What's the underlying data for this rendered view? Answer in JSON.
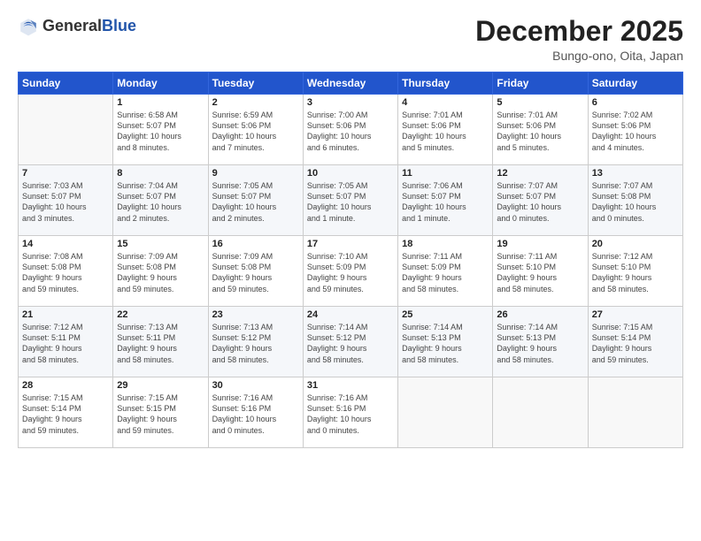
{
  "header": {
    "logo_general": "General",
    "logo_blue": "Blue",
    "month_title": "December 2025",
    "location": "Bungo-ono, Oita, Japan"
  },
  "weekdays": [
    "Sunday",
    "Monday",
    "Tuesday",
    "Wednesday",
    "Thursday",
    "Friday",
    "Saturday"
  ],
  "weeks": [
    [
      {
        "day": "",
        "info": ""
      },
      {
        "day": "1",
        "info": "Sunrise: 6:58 AM\nSunset: 5:07 PM\nDaylight: 10 hours\nand 8 minutes."
      },
      {
        "day": "2",
        "info": "Sunrise: 6:59 AM\nSunset: 5:06 PM\nDaylight: 10 hours\nand 7 minutes."
      },
      {
        "day": "3",
        "info": "Sunrise: 7:00 AM\nSunset: 5:06 PM\nDaylight: 10 hours\nand 6 minutes."
      },
      {
        "day": "4",
        "info": "Sunrise: 7:01 AM\nSunset: 5:06 PM\nDaylight: 10 hours\nand 5 minutes."
      },
      {
        "day": "5",
        "info": "Sunrise: 7:01 AM\nSunset: 5:06 PM\nDaylight: 10 hours\nand 5 minutes."
      },
      {
        "day": "6",
        "info": "Sunrise: 7:02 AM\nSunset: 5:06 PM\nDaylight: 10 hours\nand 4 minutes."
      }
    ],
    [
      {
        "day": "7",
        "info": "Sunrise: 7:03 AM\nSunset: 5:07 PM\nDaylight: 10 hours\nand 3 minutes."
      },
      {
        "day": "8",
        "info": "Sunrise: 7:04 AM\nSunset: 5:07 PM\nDaylight: 10 hours\nand 2 minutes."
      },
      {
        "day": "9",
        "info": "Sunrise: 7:05 AM\nSunset: 5:07 PM\nDaylight: 10 hours\nand 2 minutes."
      },
      {
        "day": "10",
        "info": "Sunrise: 7:05 AM\nSunset: 5:07 PM\nDaylight: 10 hours\nand 1 minute."
      },
      {
        "day": "11",
        "info": "Sunrise: 7:06 AM\nSunset: 5:07 PM\nDaylight: 10 hours\nand 1 minute."
      },
      {
        "day": "12",
        "info": "Sunrise: 7:07 AM\nSunset: 5:07 PM\nDaylight: 10 hours\nand 0 minutes."
      },
      {
        "day": "13",
        "info": "Sunrise: 7:07 AM\nSunset: 5:08 PM\nDaylight: 10 hours\nand 0 minutes."
      }
    ],
    [
      {
        "day": "14",
        "info": "Sunrise: 7:08 AM\nSunset: 5:08 PM\nDaylight: 9 hours\nand 59 minutes."
      },
      {
        "day": "15",
        "info": "Sunrise: 7:09 AM\nSunset: 5:08 PM\nDaylight: 9 hours\nand 59 minutes."
      },
      {
        "day": "16",
        "info": "Sunrise: 7:09 AM\nSunset: 5:08 PM\nDaylight: 9 hours\nand 59 minutes."
      },
      {
        "day": "17",
        "info": "Sunrise: 7:10 AM\nSunset: 5:09 PM\nDaylight: 9 hours\nand 59 minutes."
      },
      {
        "day": "18",
        "info": "Sunrise: 7:11 AM\nSunset: 5:09 PM\nDaylight: 9 hours\nand 58 minutes."
      },
      {
        "day": "19",
        "info": "Sunrise: 7:11 AM\nSunset: 5:10 PM\nDaylight: 9 hours\nand 58 minutes."
      },
      {
        "day": "20",
        "info": "Sunrise: 7:12 AM\nSunset: 5:10 PM\nDaylight: 9 hours\nand 58 minutes."
      }
    ],
    [
      {
        "day": "21",
        "info": "Sunrise: 7:12 AM\nSunset: 5:11 PM\nDaylight: 9 hours\nand 58 minutes."
      },
      {
        "day": "22",
        "info": "Sunrise: 7:13 AM\nSunset: 5:11 PM\nDaylight: 9 hours\nand 58 minutes."
      },
      {
        "day": "23",
        "info": "Sunrise: 7:13 AM\nSunset: 5:12 PM\nDaylight: 9 hours\nand 58 minutes."
      },
      {
        "day": "24",
        "info": "Sunrise: 7:14 AM\nSunset: 5:12 PM\nDaylight: 9 hours\nand 58 minutes."
      },
      {
        "day": "25",
        "info": "Sunrise: 7:14 AM\nSunset: 5:13 PM\nDaylight: 9 hours\nand 58 minutes."
      },
      {
        "day": "26",
        "info": "Sunrise: 7:14 AM\nSunset: 5:13 PM\nDaylight: 9 hours\nand 58 minutes."
      },
      {
        "day": "27",
        "info": "Sunrise: 7:15 AM\nSunset: 5:14 PM\nDaylight: 9 hours\nand 59 minutes."
      }
    ],
    [
      {
        "day": "28",
        "info": "Sunrise: 7:15 AM\nSunset: 5:14 PM\nDaylight: 9 hours\nand 59 minutes."
      },
      {
        "day": "29",
        "info": "Sunrise: 7:15 AM\nSunset: 5:15 PM\nDaylight: 9 hours\nand 59 minutes."
      },
      {
        "day": "30",
        "info": "Sunrise: 7:16 AM\nSunset: 5:16 PM\nDaylight: 10 hours\nand 0 minutes."
      },
      {
        "day": "31",
        "info": "Sunrise: 7:16 AM\nSunset: 5:16 PM\nDaylight: 10 hours\nand 0 minutes."
      },
      {
        "day": "",
        "info": ""
      },
      {
        "day": "",
        "info": ""
      },
      {
        "day": "",
        "info": ""
      }
    ]
  ]
}
